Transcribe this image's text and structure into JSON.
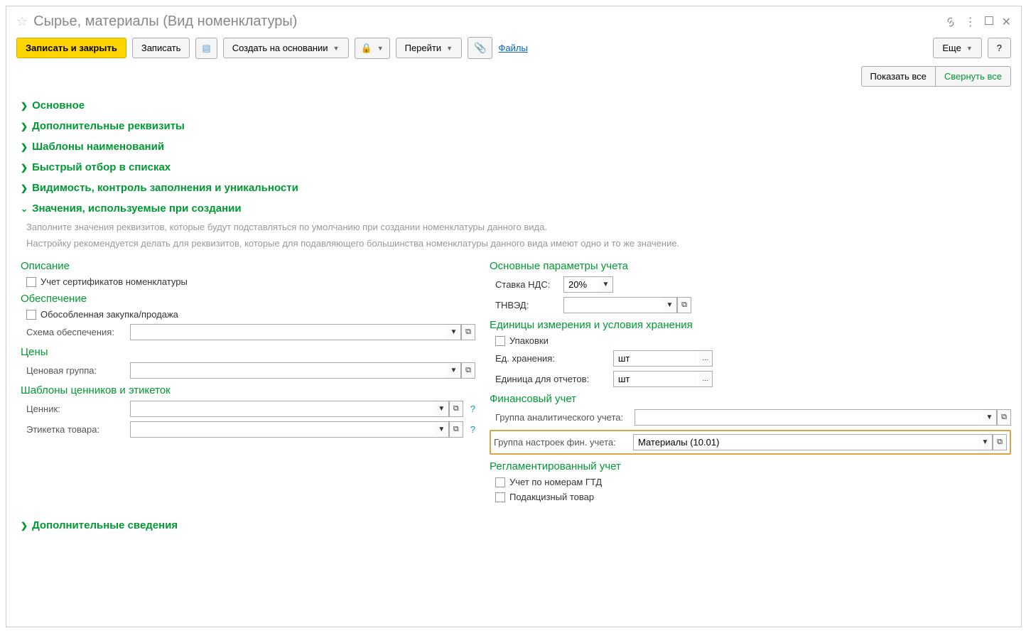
{
  "title": "Сырье, материалы (Вид номенклатуры)",
  "toolbar": {
    "save_close": "Записать и закрыть",
    "save": "Записать",
    "create_based": "Создать на основании",
    "goto": "Перейти",
    "files": "Файлы",
    "more": "Еще",
    "help": "?"
  },
  "secondary": {
    "show_all": "Показать все",
    "collapse_all": "Свернуть все"
  },
  "sections": {
    "main": "Основное",
    "additional": "Дополнительные реквизиты",
    "name_templates": "Шаблоны наименований",
    "quick_filter": "Быстрый отбор в списках",
    "visibility": "Видимость, контроль заполнения и уникальности",
    "defaults": "Значения, используемые при создании",
    "extra_info": "Дополнительные сведения"
  },
  "hints": {
    "line1": "Заполните значения реквизитов, которые будут подставляться по умолчанию при создании номенклатуры данного вида.",
    "line2": "Настройку рекомендуется делать для реквизитов, которые для подавляющего большинства номенклатуры данного вида имеют одно и то же значение."
  },
  "left": {
    "description_title": "Описание",
    "cert_accounting": "Учет сертификатов номенклатуры",
    "provision_title": "Обеспечение",
    "separate_purchase": "Обособленная закупка/продажа",
    "provision_scheme_label": "Схема обеспечения:",
    "provision_scheme_value": "",
    "prices_title": "Цены",
    "price_group_label": "Ценовая группа:",
    "price_group_value": "",
    "tags_title": "Шаблоны ценников и этикеток",
    "price_tag_label": "Ценник:",
    "price_tag_value": "",
    "goods_label_label": "Этикетка товара:",
    "goods_label_value": ""
  },
  "right": {
    "accounting_params_title": "Основные параметры учета",
    "vat_label": "Ставка НДС:",
    "vat_value": "20%",
    "tnved_label": "ТНВЭД:",
    "tnved_value": "",
    "units_title": "Единицы измерения и условия хранения",
    "packaging": "Упаковки",
    "storage_unit_label": "Ед. хранения:",
    "storage_unit_value": "шт",
    "report_unit_label": "Единица для отчетов:",
    "report_unit_value": "шт",
    "fin_title": "Финансовый учет",
    "analytic_group_label": "Группа аналитического учета:",
    "analytic_group_value": "",
    "fin_settings_label": "Группа настроек фин. учета:",
    "fin_settings_value": "Материалы (10.01)",
    "regulated_title": "Регламентированный учет",
    "gtd_numbers": "Учет по номерам ГТД",
    "excise": "Подакцизный товар"
  }
}
